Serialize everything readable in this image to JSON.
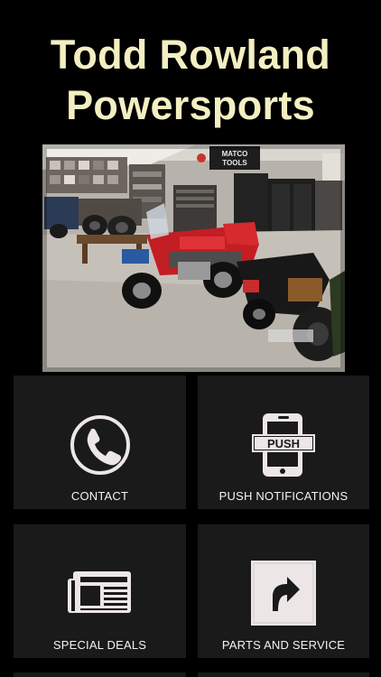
{
  "header": {
    "title_line1": "Todd Rowland",
    "title_line2": "Powersports"
  },
  "hero": {
    "sign_text": "MATCO TOOLS"
  },
  "menu": {
    "items": [
      {
        "label": "CONTACT",
        "icon": "phone-icon"
      },
      {
        "label": "PUSH NOTIFICATIONS",
        "icon": "push-notification-icon",
        "icon_text": "PUSH"
      },
      {
        "label": "SPECIAL DEALS",
        "icon": "newspaper-icon"
      },
      {
        "label": "PARTS AND SERVICE",
        "icon": "shortcut-arrow-icon"
      }
    ]
  },
  "colors": {
    "background": "#000000",
    "title": "#f3efc2",
    "tile": "#1a1a1a",
    "tile_text": "#f2f2f2",
    "icon": "#ece6e6"
  }
}
